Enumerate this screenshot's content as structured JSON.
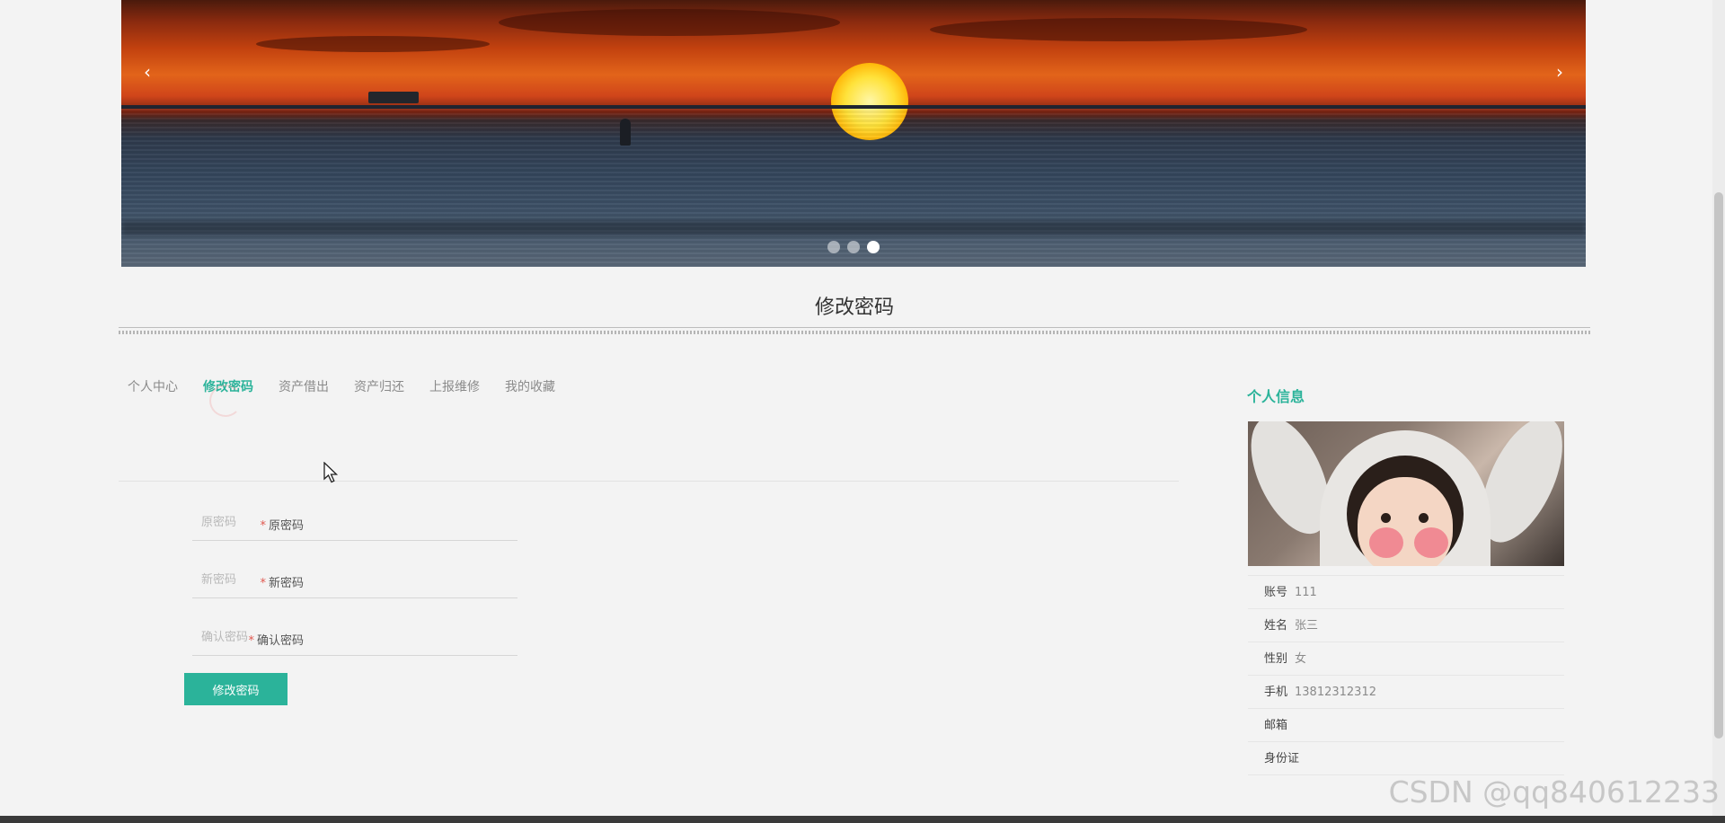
{
  "banner": {
    "prev_icon": "chevron-left-icon",
    "next_icon": "chevron-right-icon",
    "slide_count": 3,
    "active_slide": 3
  },
  "page_title": "修改密码",
  "tabs": [
    {
      "label": "个人中心",
      "active": false
    },
    {
      "label": "修改密码",
      "active": true
    },
    {
      "label": "资产借出",
      "active": false
    },
    {
      "label": "资产归还",
      "active": false
    },
    {
      "label": "上报维修",
      "active": false
    },
    {
      "label": "我的收藏",
      "active": false
    }
  ],
  "form": {
    "required_mark": "*",
    "old_password": {
      "label": "原密码",
      "placeholder": "原密码",
      "value": ""
    },
    "new_password": {
      "label": "新密码",
      "placeholder": "新密码",
      "value": ""
    },
    "confirm_password": {
      "label": "确认密码",
      "placeholder": "确认密码",
      "value": ""
    },
    "submit_label": "修改密码"
  },
  "sidebar": {
    "title": "个人信息",
    "fields": [
      {
        "key": "账号",
        "value": "111"
      },
      {
        "key": "姓名",
        "value": "张三"
      },
      {
        "key": "性别",
        "value": "女"
      },
      {
        "key": "手机",
        "value": "13812312312"
      },
      {
        "key": "邮箱",
        "value": ""
      },
      {
        "key": "身份证",
        "value": ""
      }
    ]
  },
  "watermark": "CSDN @qq840612233",
  "colors": {
    "accent": "#2bb39a",
    "required": "#e0584f",
    "background": "#f3f3f3"
  }
}
